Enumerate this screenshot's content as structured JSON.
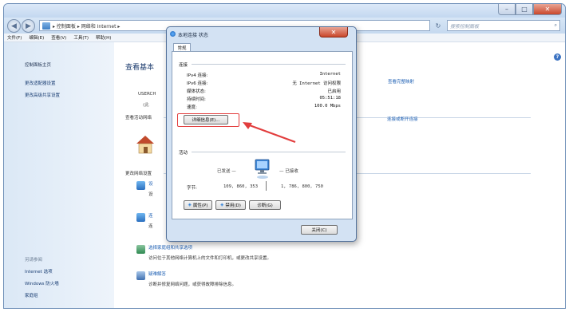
{
  "window": {
    "min_glyph": "–",
    "max_glyph": "□",
    "close_glyph": "✕"
  },
  "nav": {
    "back": "◀",
    "forward": "▶",
    "breadcrumb": "▸ 控制面板 ▸ 网络和 Internet ▸",
    "refresh": "↻",
    "search_placeholder": "搜索控制面板",
    "search_glyph": "⌕"
  },
  "menu": [
    "文件(F)",
    "编辑(E)",
    "查看(V)",
    "工具(T)",
    "帮助(H)"
  ],
  "sidebar": {
    "home": "控制面板主页",
    "links": [
      "更改适配器设置",
      "更改高级共享设置"
    ],
    "see_also_heading": "另请参阅",
    "see_also": [
      "Internet 选项",
      "Windows 防火墙",
      "家庭组"
    ]
  },
  "main": {
    "title": "查看基本",
    "computer": "USERCH",
    "sub": "(此",
    "active_networks": "查看活动网络",
    "full_map_link": "查看完整映射",
    "connect_link": "连接或断开连接",
    "change_settings": "更改网络设置",
    "tasks": [
      {
        "title": "设",
        "desc": "设"
      },
      {
        "title": "连",
        "desc": "连"
      },
      {
        "title": "选择家庭组和共享选项",
        "desc": "访问位于其他网络计算机上的文件和打印机，或更改共享设置。"
      },
      {
        "title": "疑难解答",
        "desc": "诊断并修复网络问题，或获得故障排除信息。"
      }
    ],
    "help_glyph": "?"
  },
  "dialog": {
    "title": "本地连接 状态",
    "close_glyph": "✕",
    "tab": "常规",
    "connection_group": "连接",
    "rows": [
      {
        "k": "IPv4 连接:",
        "v": "Internet"
      },
      {
        "k": "IPv6 连接:",
        "v": "无 Internet 访问权限"
      },
      {
        "k": "媒体状态:",
        "v": "已启用"
      },
      {
        "k": "持续时间:",
        "v": "05:51:18"
      },
      {
        "k": "速度:",
        "v": "100.0 Mbps"
      }
    ],
    "details_button": "详细信息(E)...",
    "activity_group": "活动",
    "sent_label": "已发送 —",
    "received_label": "— 已接收",
    "bytes_label": "字节:",
    "bytes_sent": "109, 860, 353",
    "bytes_received": "1, 786, 800, 750",
    "properties_button": "属性(P)",
    "disable_button": "禁用(D)",
    "diagnose_button": "诊断(G)",
    "close_button": "关闭(C)"
  },
  "colors": {
    "highlight": "#e23d3d",
    "link": "#1d5fb3",
    "title_blue": "#1e3d6f"
  }
}
